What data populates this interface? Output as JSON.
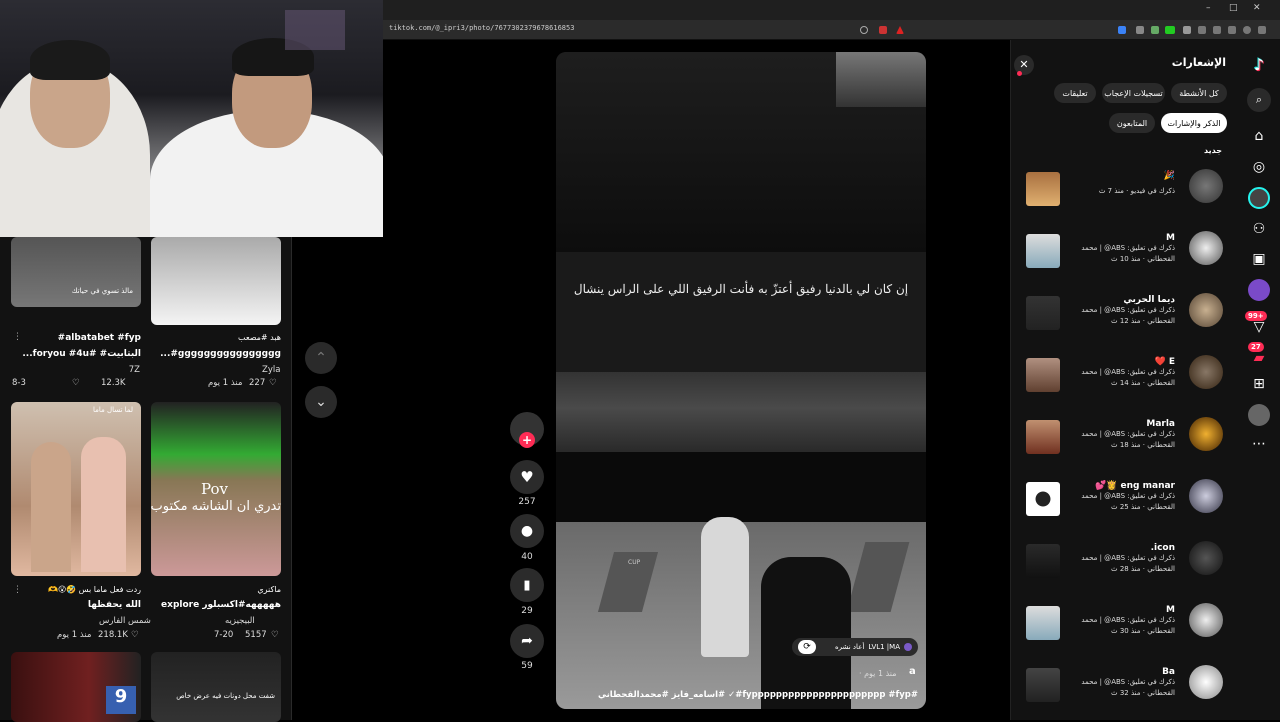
{
  "browser": {
    "url": "tiktok.com/@_ipri3/photo/7677302379678616853",
    "window_controls": [
      "–",
      "□",
      "✕"
    ]
  },
  "feed": {
    "cards": [
      {
        "caption_line1": "albatabet #fyp#",
        "caption_line2": "البتابيت# #foryou #4u...",
        "author": "7Z",
        "views": "12.3K",
        "date": "8-3",
        "overlay_text": "مالذ تسوي في حياتك"
      },
      {
        "caption_line1": "هبد #مصعب",
        "caption_line2": "gggggggggggggggg#...",
        "author": "Zyla",
        "views": "227",
        "date": "منذ 1 يوم"
      },
      {
        "caption_line1": "ردت فعل ماما بس 🤣😮🫶",
        "caption_line2": "الله يحفظها",
        "author": "شمس الفارس",
        "views": "218.1K",
        "date": "منذ 1 يوم",
        "overlay_text": "لما تسأل ماما"
      },
      {
        "caption_line1": "ماكنري",
        "caption_line2": "هههههه#اكسبلور explore",
        "author": "البيجيزيه",
        "views": "5157",
        "date": "7-20",
        "overlay_text": "Pov",
        "overlay_text2": "تدري ان الشاشه مكتوب"
      },
      {
        "overlay_text": "9"
      },
      {
        "overlay_text": "شفت محل دونات فيه عرض خاص"
      }
    ]
  },
  "video": {
    "arabic_text": "إن كان لي بالدنيا رفيق أعتزّ به فأنت الرفيق اللي على الراس ينشال",
    "repost_label": "أعاد نشره",
    "repost_user": "LVL1 |MA",
    "time_meta": "منذ 1 يوم ·",
    "author_letter": "a",
    "caption": "#fypppppppppppppppppppppp #fyp#✓ #اسامه_فايز #محمدالقحطاني",
    "likes": "257",
    "comments": "40",
    "saves": "29",
    "shares": "59",
    "cup_label": "CUP"
  },
  "notifications": {
    "title": "الإشعارات",
    "tabs": [
      "كل الأنشطة",
      "تسجيلات الإعجاب",
      "تعليقات",
      "الذكر والإشارات",
      "المتابعون"
    ],
    "section_label": "جديد",
    "items": [
      {
        "name": "🎉",
        "line1": "ذكرك في فيديو · منذ 7 ث",
        "line2": ""
      },
      {
        "name": "M",
        "line1": "ذكرك في تعليق: ABS@ | محمد",
        "line2": "القحطاني · منذ 10 ث"
      },
      {
        "name": "ديما الحربي",
        "line1": "ذكرك في تعليق: ABS@ | محمد",
        "line2": "القحطاني · منذ 12 ث"
      },
      {
        "name": "E ❤️",
        "line1": "ذكرك في تعليق: ABS@ | محمد",
        "line2": "القحطاني · منذ 14 ث"
      },
      {
        "name": "Marla",
        "line1": "ذكرك في تعليق: ABS@ | محمد",
        "line2": "القحطاني · منذ 18 ث"
      },
      {
        "name": "eng manar 👸💕",
        "line1": "ذكرك في تعليق: ABS@ | محمد",
        "line2": "القحطاني · منذ 25 ث"
      },
      {
        "name": "icon.",
        "line1": "ذكرك في تعليق: ABS@ | محمد",
        "line2": "القحطاني · منذ 28 ث"
      },
      {
        "name": "M",
        "line1": "ذكرك في تعليق: ABS@ | محمد",
        "line2": "القحطاني · منذ 30 ث"
      },
      {
        "name": "Ba",
        "line1": "ذكرك في تعليق: ABS@ | محمد",
        "line2": "القحطاني · منذ 32 ث"
      }
    ]
  },
  "sidenav": {
    "messages_badge": "99+",
    "inbox_badge": "27"
  },
  "colors": {
    "accent": "#fe2c55",
    "panel": "#121212",
    "pill": "#2a2a2a"
  }
}
